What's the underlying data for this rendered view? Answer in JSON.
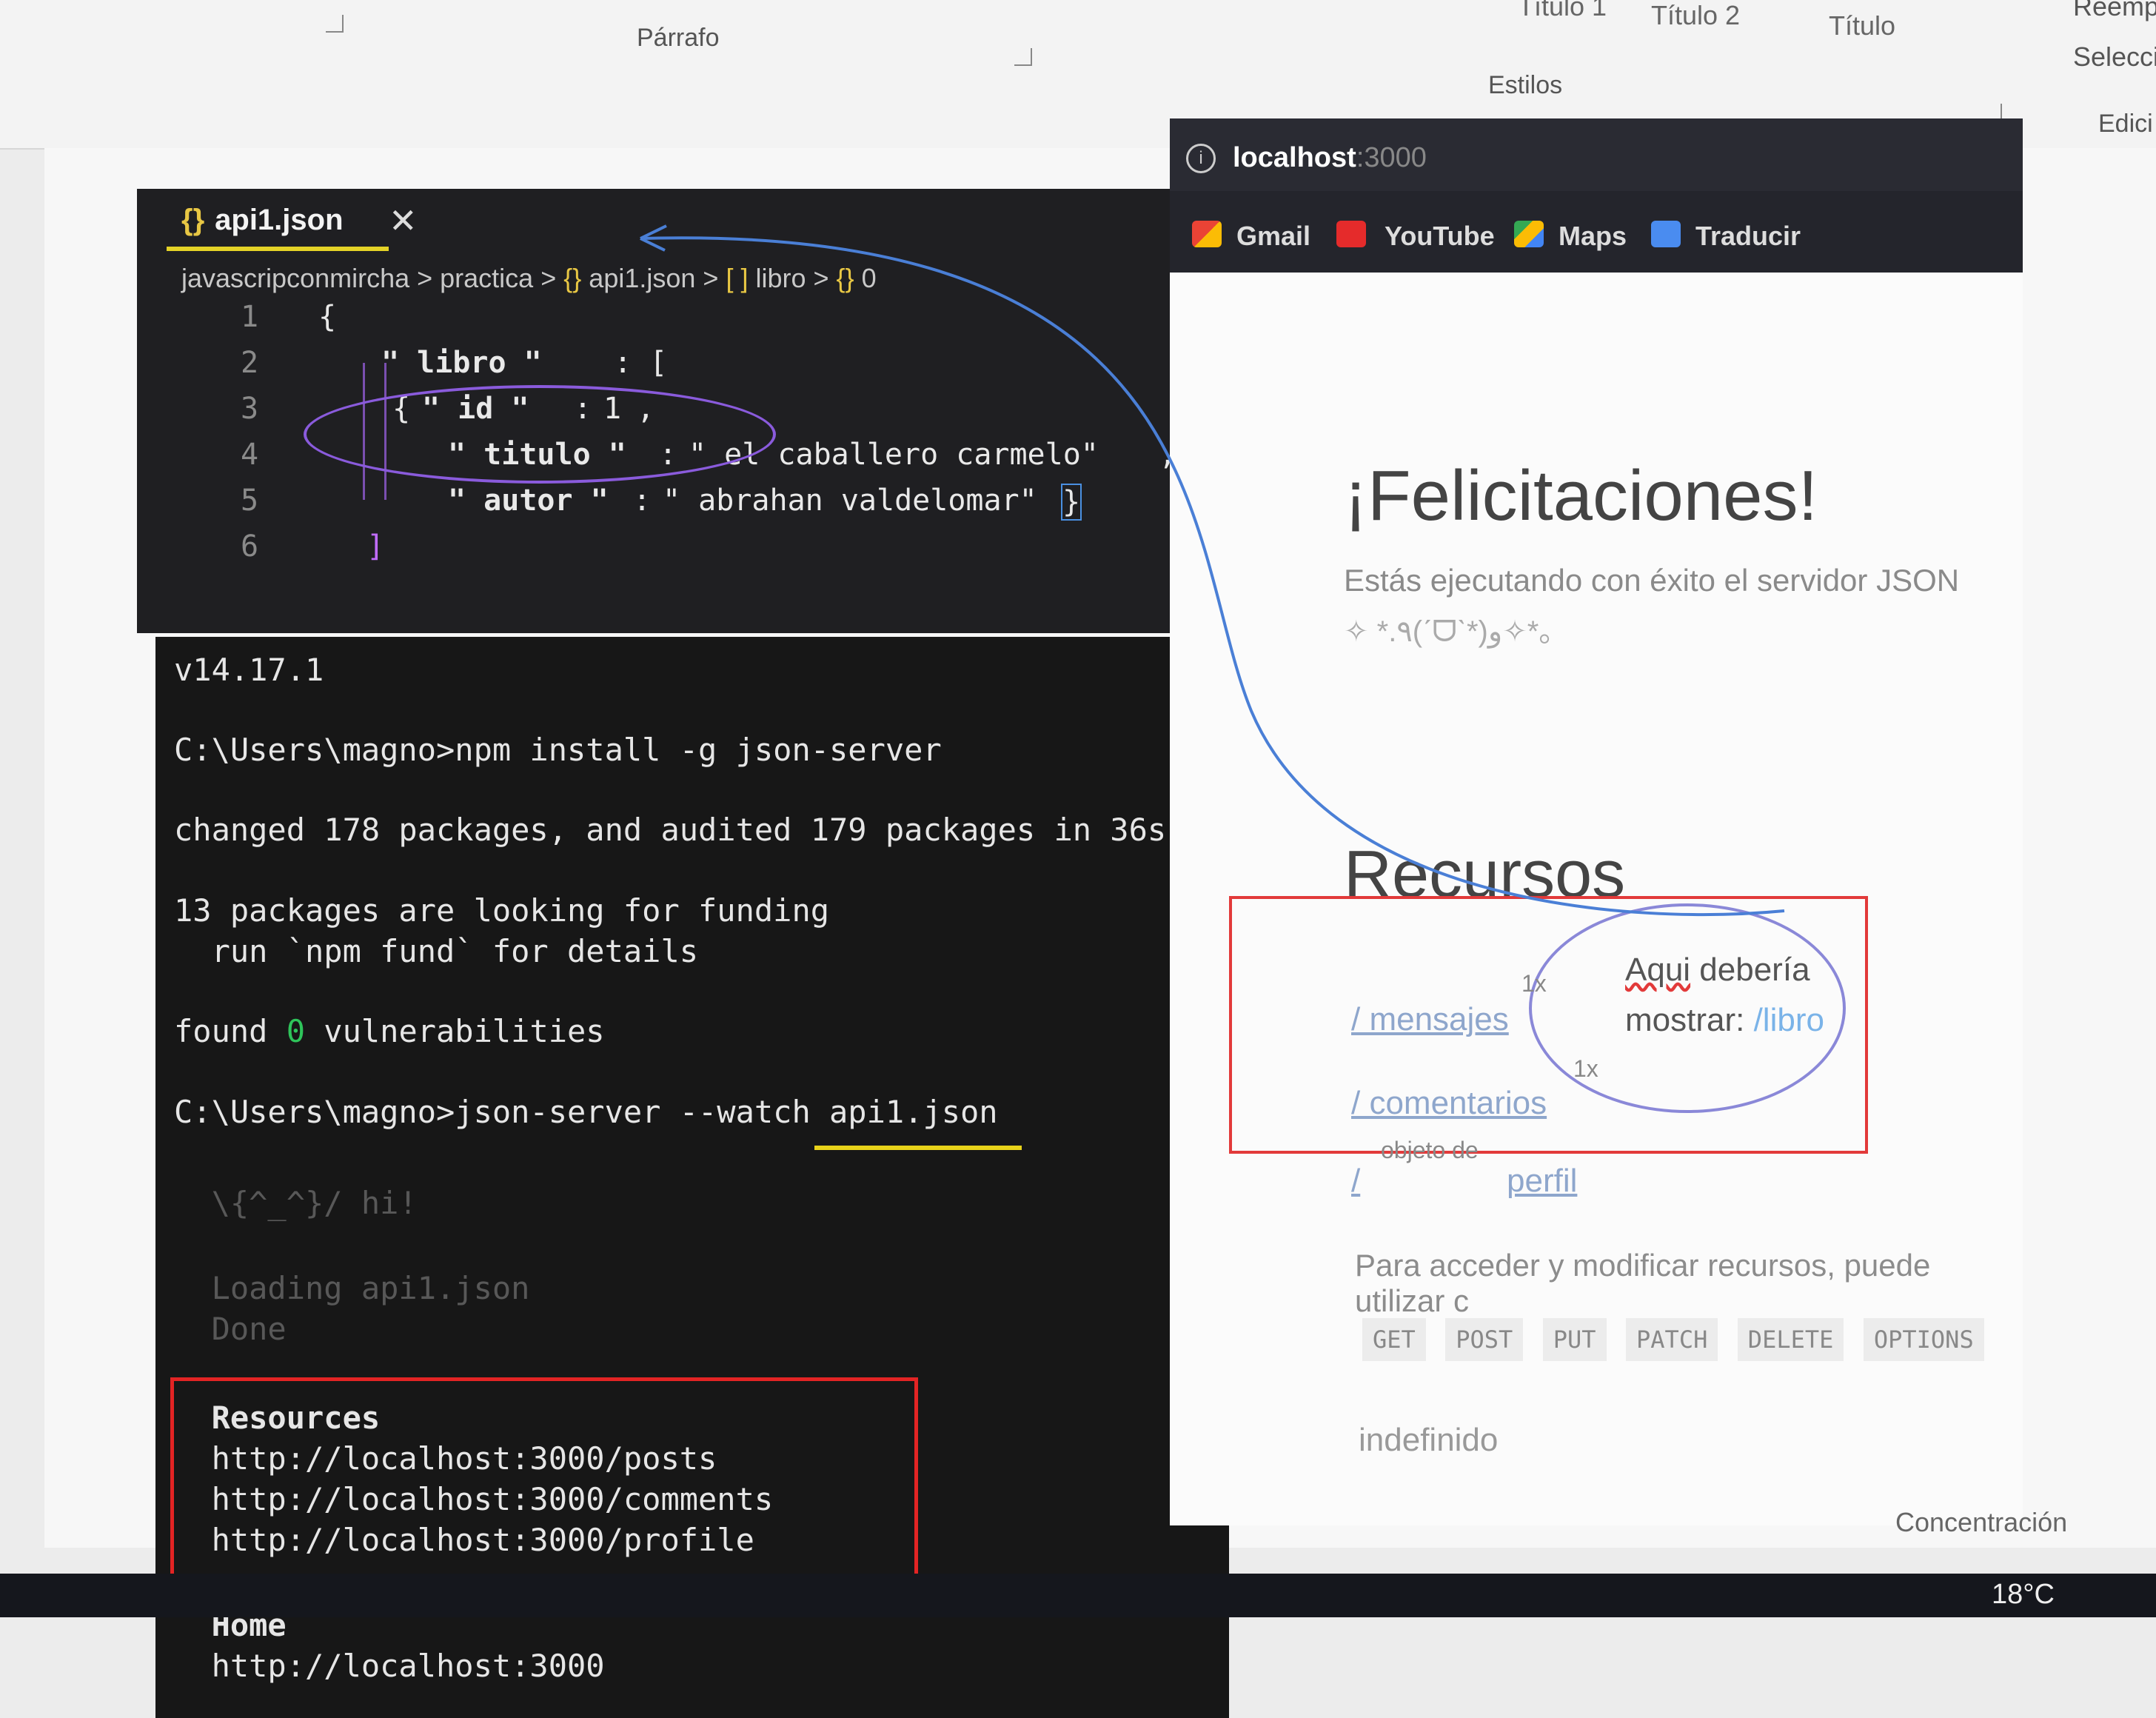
{
  "ribbon": {
    "paragraph_label": "Párrafo",
    "styles_label": "Estilos",
    "edit_label": "Edici",
    "style_items": [
      "Título 1",
      "Título 2",
      "Título"
    ],
    "replace_label": "Reemp",
    "select_label": "Selecci"
  },
  "editor": {
    "tab_name": "api1.json",
    "tab_close": "✕",
    "breadcrumb": {
      "folder1": "javascripconmircha",
      "folder2": "practica",
      "file": "api1.json",
      "array": "libro",
      "index": "0"
    },
    "line_numbers": [
      "1",
      "2",
      "3",
      "4",
      "5",
      "6"
    ],
    "code": {
      "l1": "{",
      "l2_key": "\" libro \"",
      "l2_rest": " : [",
      "l3_open": "{",
      "l3_key": "\" id \"",
      "l3_val": "1",
      "l4_key": "\" titulo \"",
      "l4_val": "\" el caballero carmelo\"",
      "l5_key": "\" autor \"",
      "l5_val": "\" abrahan valdelomar\"",
      "l5_close": "}",
      "l6": "]"
    }
  },
  "terminal": {
    "lines": [
      "v14.17.1",
      "C:\\Users\\magno>npm install -g json-server",
      "changed 178 packages, and audited 179 packages in 36s",
      "13 packages are looking for funding",
      "  run `npm fund` for details",
      "found ",
      " vulnerabilities",
      "C:\\Users\\magno>json-server --watch api1.json",
      "  \\{^_^}/ hi!",
      "  Loading api1.json",
      "  Done",
      "  Resources",
      "  http://localhost:3000/posts",
      "  http://localhost:3000/comments",
      "  http://localhost:3000/profile",
      "  Home",
      "  http://localhost:3000"
    ],
    "zero": "0"
  },
  "browser": {
    "url_host": "localhost",
    "url_port": ":3000",
    "bookmarks": [
      "Gmail",
      "YouTube",
      "Maps",
      "Traducir"
    ],
    "title": "¡Felicitaciones!",
    "subtitle": "Estás ejecutando con éxito el servidor JSON",
    "kaomoji": "✧ *.٩(ˊᗜˋ*)و✧*。",
    "resources_heading": "Recursos",
    "links": [
      "/ mensajes",
      "/ comentarios",
      "/",
      "perfil"
    ],
    "link_note": "objeto de",
    "count_1": "1x",
    "count_2": "1x",
    "hint_line1_u": "Aqui",
    "hint_line1_rest": " debería",
    "hint_line2": "mostrar: ",
    "hint_link": "/libro",
    "paragraph": "Para acceder y modificar recursos, puede utilizar c",
    "methods": [
      "GET",
      "POST",
      "PUT",
      "PATCH",
      "DELETE",
      "OPTIONS"
    ],
    "undefined": "indefinido"
  },
  "status": {
    "focus": "Concentración",
    "temperature": "18°C"
  }
}
